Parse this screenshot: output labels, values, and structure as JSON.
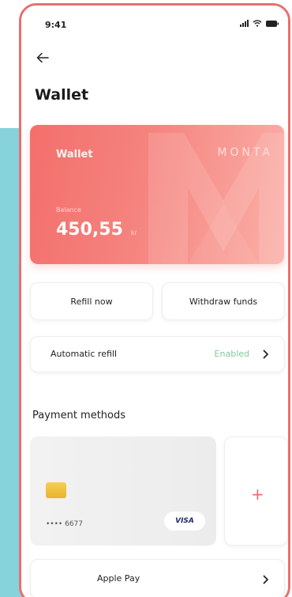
{
  "status_bar": {
    "time": "9:41",
    "icons": [
      "signal-icon",
      "wifi-icon",
      "battery-icon"
    ]
  },
  "header": {
    "back_icon": "arrow-left-icon",
    "title": "Wallet"
  },
  "wallet_card": {
    "name": "Wallet",
    "brand": "MONTA",
    "balance_label": "Balance",
    "balance": "450,55",
    "currency": "kr"
  },
  "actions": {
    "refill_label": "Refill now",
    "withdraw_label": "Withdraw funds"
  },
  "automatic_refill": {
    "label": "Automatic refill",
    "status": "Enabled"
  },
  "payment_methods": {
    "title": "Payment methods",
    "card": {
      "number": "•••• 6677",
      "network": "VISA"
    },
    "add_label": "+",
    "apple_pay_label": "Apple Pay"
  },
  "colors": {
    "accent": "#e96f70",
    "card_gradient_start": "#f36f6c",
    "card_gradient_end": "#fbb0a8",
    "enabled_green": "#7ec9a0",
    "teal_background": "#86d3db"
  }
}
